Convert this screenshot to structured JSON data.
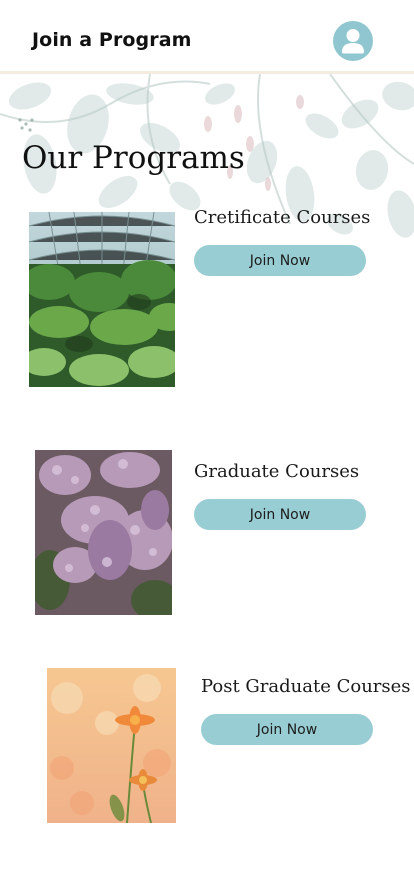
{
  "header": {
    "title": "Join a Program",
    "avatar_icon": "user-icon"
  },
  "page": {
    "section_title": "Our Programs",
    "accent": "#98cdd3"
  },
  "programs": [
    {
      "title": "Cretificate Courses",
      "button": "Join Now",
      "image": "greenhouse-plants-photo"
    },
    {
      "title": "Graduate Courses",
      "button": "Join Now",
      "image": "lilac-flowers-photo"
    },
    {
      "title": "Post Graduate Courses",
      "button": "Join Now",
      "image": "orange-flowers-photo"
    }
  ]
}
